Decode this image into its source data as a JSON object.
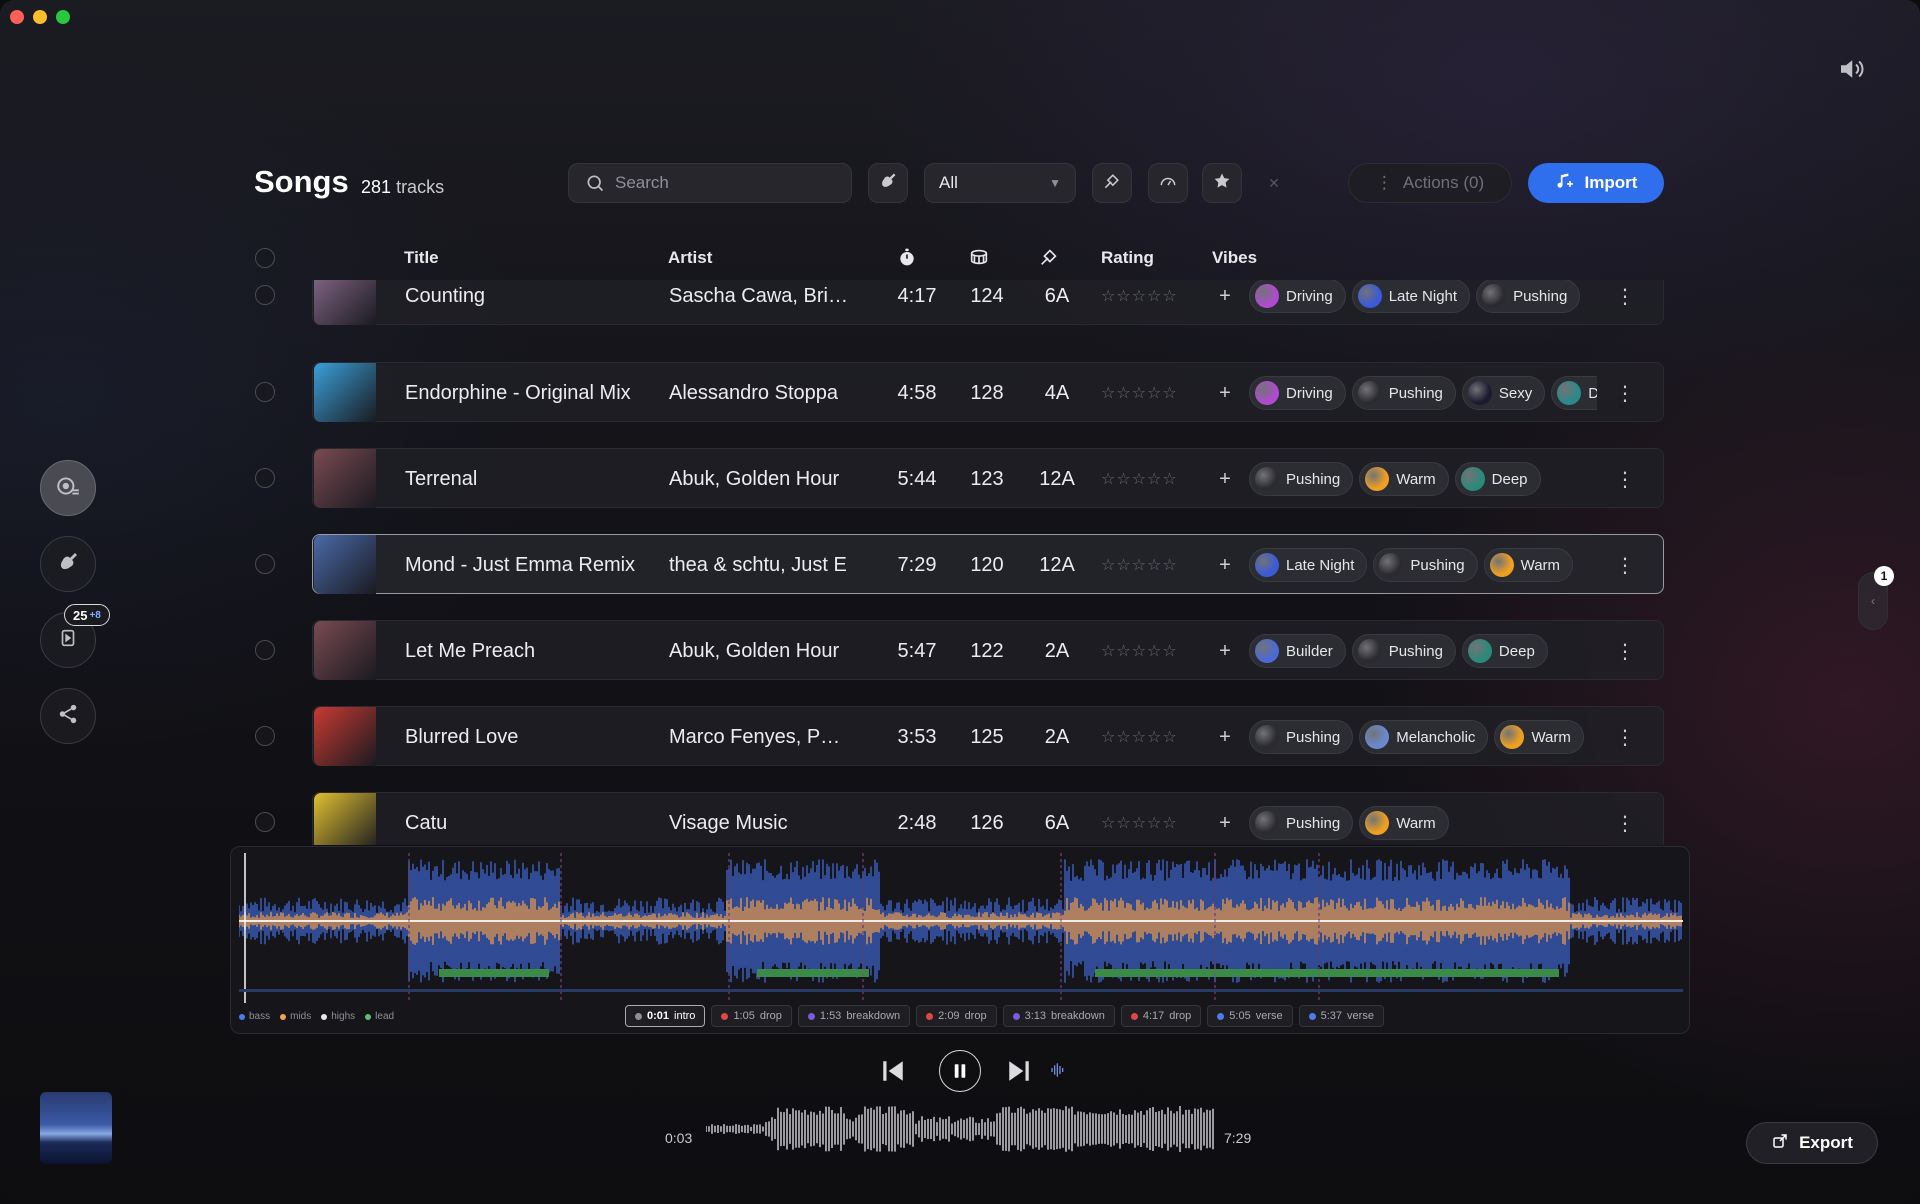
{
  "header": {
    "title": "Songs",
    "track_count": "281",
    "track_count_suffix": "tracks",
    "search_placeholder": "Search",
    "filter_value": "All",
    "actions_label": "Actions (0)",
    "import_label": "Import"
  },
  "columns": {
    "title": "Title",
    "artist": "Artist",
    "rating": "Rating",
    "vibes": "Vibes"
  },
  "rail": {
    "badge_count": "25",
    "badge_extra": "+8"
  },
  "tracks": [
    {
      "title": "Counting",
      "artist": "Sascha Cawa, Bri…",
      "duration": "4:17",
      "bpm": "124",
      "key": "6A",
      "rating": "☆☆☆☆☆",
      "thumb_color": "#8a6a8c",
      "vibes": [
        "Driving",
        "Late Night",
        "Pushing"
      ]
    },
    {
      "title": "Endorphine - Original Mix",
      "artist": "Alessandro Stoppa",
      "duration": "4:58",
      "bpm": "128",
      "key": "4A",
      "rating": "☆☆☆☆☆",
      "thumb_color": "#3aa0d8",
      "vibes": [
        "Driving",
        "Pushing",
        "Sexy",
        "D"
      ]
    },
    {
      "title": "Terrenal",
      "artist": "Abuk, Golden Hour",
      "duration": "5:44",
      "bpm": "123",
      "key": "12A",
      "rating": "☆☆☆☆☆",
      "thumb_color": "#7a4a52",
      "vibes": [
        "Pushing",
        "Warm",
        "Deep"
      ]
    },
    {
      "title": "Mond - Just Emma Remix",
      "artist": "thea & schtu, Just E",
      "duration": "7:29",
      "bpm": "120",
      "key": "12A",
      "rating": "☆☆☆☆☆",
      "thumb_color": "#4a6aa8",
      "vibes": [
        "Late Night",
        "Pushing",
        "Warm"
      ]
    },
    {
      "title": "Let Me Preach",
      "artist": "Abuk, Golden Hour",
      "duration": "5:47",
      "bpm": "122",
      "key": "2A",
      "rating": "☆☆☆☆☆",
      "thumb_color": "#7a4a52",
      "vibes": [
        "Builder",
        "Pushing",
        "Deep"
      ]
    },
    {
      "title": "Blurred Love",
      "artist": "Marco Fenyes, P…",
      "duration": "3:53",
      "bpm": "125",
      "key": "2A",
      "rating": "☆☆☆☆☆",
      "thumb_color": "#c83a32",
      "vibes": [
        "Pushing",
        "Melancholic",
        "Warm"
      ]
    },
    {
      "title": "Catu",
      "artist": "Visage Music",
      "duration": "2:48",
      "bpm": "126",
      "key": "6A",
      "rating": "☆☆☆☆☆",
      "thumb_color": "#e0c030",
      "vibes": [
        "Pushing",
        "Warm"
      ]
    }
  ],
  "vibe_colors": {
    "Driving": "#b04ad0",
    "Late Night": "#3a5ad8",
    "Pushing": "#2a2a30",
    "Sexy": "#1a1a30",
    "D": "#2a8a8a",
    "Warm": "#f0a020",
    "Deep": "#2a8a7a",
    "Builder": "#4a6ad8",
    "Melancholic": "#6a8ad0"
  },
  "waveform": {
    "legend": [
      {
        "label": "bass",
        "color": "#4a7cf0"
      },
      {
        "label": "mids",
        "color": "#f0a050"
      },
      {
        "label": "highs",
        "color": "#e8e8ec"
      },
      {
        "label": "lead",
        "color": "#5ac070"
      }
    ],
    "markers": [
      {
        "time": "0:01",
        "label": "intro",
        "color": "#8f8f97",
        "active": true
      },
      {
        "time": "1:05",
        "label": "drop",
        "color": "#e04848"
      },
      {
        "time": "1:53",
        "label": "breakdown",
        "color": "#7a5ae0"
      },
      {
        "time": "2:09",
        "label": "drop",
        "color": "#e04848"
      },
      {
        "time": "3:13",
        "label": "breakdown",
        "color": "#7a5ae0"
      },
      {
        "time": "4:17",
        "label": "drop",
        "color": "#e04848"
      },
      {
        "time": "5:05",
        "label": "verse",
        "color": "#4a7cf0"
      },
      {
        "time": "5:37",
        "label": "verse",
        "color": "#4a7cf0"
      }
    ]
  },
  "player": {
    "current_time": "0:03",
    "total_time": "7:29"
  },
  "export_label": "Export",
  "side_badge": "1"
}
